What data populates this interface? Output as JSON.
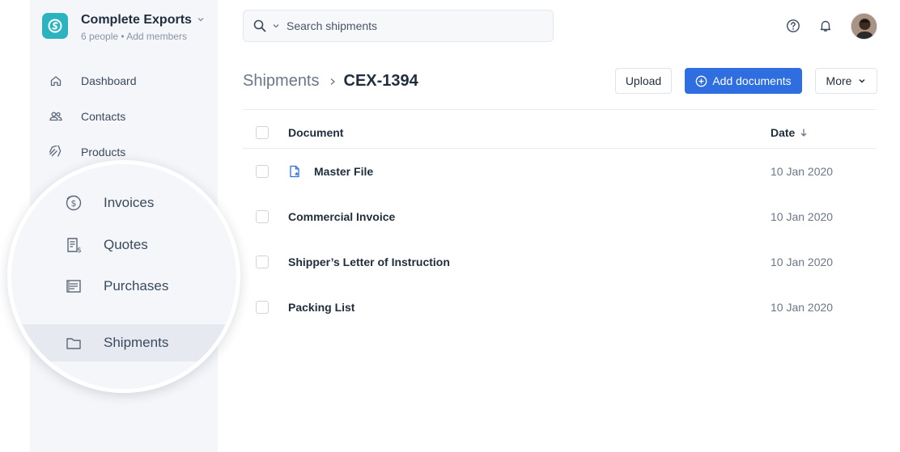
{
  "workspace": {
    "name": "Complete Exports",
    "subtitle": "6 people • Add members"
  },
  "sidebar": {
    "items": [
      {
        "label": "Dashboard",
        "icon": "home-icon"
      },
      {
        "label": "Contacts",
        "icon": "people-icon"
      },
      {
        "label": "Products",
        "icon": "tag-icon"
      }
    ]
  },
  "magnified": {
    "items": [
      {
        "label": "Invoices",
        "icon": "dollar-coin-icon"
      },
      {
        "label": "Quotes",
        "icon": "receipt-icon"
      },
      {
        "label": "Purchases",
        "icon": "ledger-icon"
      },
      {
        "label": "Shipments",
        "icon": "folder-icon",
        "active": true
      }
    ]
  },
  "search": {
    "placeholder": "Search shipments"
  },
  "header": {
    "breadcrumb_root": "Shipments",
    "breadcrumb_current": "CEX-1394"
  },
  "actions": {
    "upload": "Upload",
    "add_documents": "Add documents",
    "more": "More"
  },
  "table": {
    "columns": {
      "document": "Document",
      "date": "Date"
    },
    "rows": [
      {
        "name": "Master File",
        "date": "10 Jan 2020",
        "icon": "starred-file-icon"
      },
      {
        "name": "Commercial Invoice",
        "date": "10 Jan 2020"
      },
      {
        "name": "Shipper’s Letter of Instruction",
        "date": "10 Jan 2020"
      },
      {
        "name": "Packing List",
        "date": "10 Jan 2020"
      }
    ]
  },
  "colors": {
    "accent": "#2f6ee0",
    "brand": "#2bb3c0",
    "sidebar_bg": "#f4f6f9"
  }
}
